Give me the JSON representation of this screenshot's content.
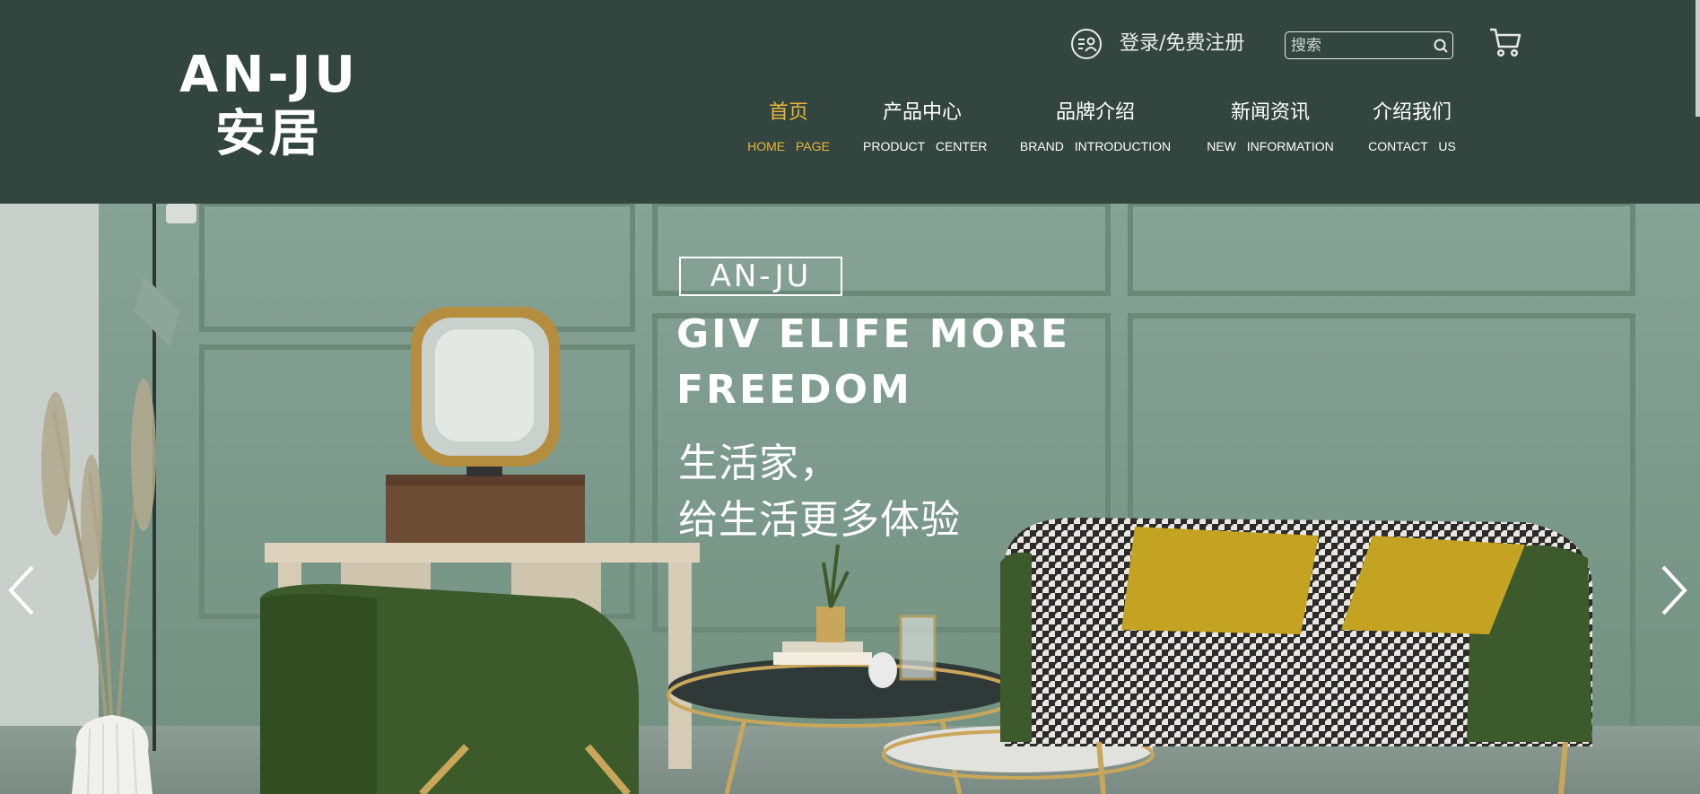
{
  "logo": {
    "en": "AN-JU",
    "cn": "安居"
  },
  "header": {
    "login_label": "登录/免费注册",
    "search_placeholder": "搜索",
    "icons": [
      "user-icon",
      "search-icon",
      "cart-icon"
    ]
  },
  "nav": {
    "items": [
      {
        "cn": "首页",
        "en": "HOME PAGE",
        "active": true
      },
      {
        "cn": "产品中心",
        "en": "PRODUCT CENTER",
        "active": false
      },
      {
        "cn": "品牌介绍",
        "en": "BRAND INTRODUCTION",
        "active": false
      },
      {
        "cn": "新闻资讯",
        "en": "NEW INFORMATION",
        "active": false
      },
      {
        "cn": "介绍我们",
        "en": "CONTACT US",
        "active": false
      }
    ]
  },
  "hero": {
    "tag": "AN-JU",
    "line1": "GIV ELIFE MORE",
    "line2": "FREEDOM",
    "cn_line1": "生活家，",
    "cn_line2": "给生活更多体验"
  },
  "colors": {
    "header_bg": "#33453f",
    "accent": "#e8b73c",
    "wall": "#7e9a8e",
    "sofa_green": "#3d5a2c",
    "pillow": "#c4a323"
  }
}
